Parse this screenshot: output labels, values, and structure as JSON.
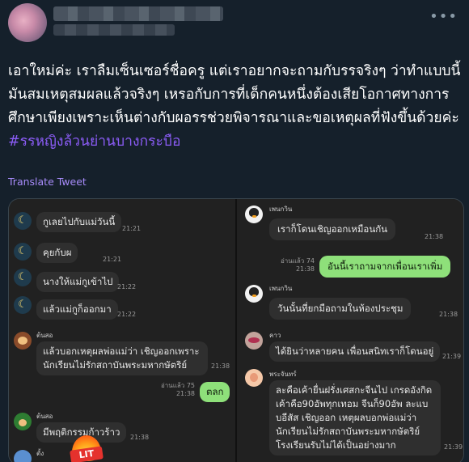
{
  "tweet": {
    "more_label": "•••",
    "text_main": "เอาใหม่ค่ะ เราลืมเซ็นเซอร์ชื่อครู แต่เราอยากจะถามกับรรจริงๆ ว่าทำแบบนี้มันสมเหตุสมผลแล้วจริงๆ เหรอกับการที่เด็กคนหนึ่งต้องเสียโอกาศทางการศึกษาเพียงเพราะเห็นต่างกับผอรรช่วยพิจารณาและขอเหตุผลที่ฟังขึ้นด้วยค่ะ ",
    "hashtag": "#รรหญิงล้วนย่านบางกระบือ",
    "translate_label": "Translate Tweet",
    "accent_color": "#8b5cf6"
  },
  "left_chat": {
    "sticker_text": "LIT",
    "messages": [
      {
        "text": "กูเลยไปกับแม่วันนี้",
        "time": "21:21"
      },
      {
        "text": "คุยกับผ",
        "time": "21:21"
      },
      {
        "text": "นางให้แม่กูเข้าไป",
        "time": "21:22"
      },
      {
        "text": "แล้วแม่กูก็ออกมา",
        "time": "21:22"
      },
      {
        "sender": "ต้นสอ",
        "text": "แล้วบอกเหตุผลพ่อแม่ว่า เชิญออกเพราะนักเรียนไม่รักสถาบันพระมหากษัตริย์",
        "time": "21:38"
      },
      {
        "text": "ตลก",
        "read": "อ่านแล้ว 75",
        "time": "21:38"
      },
      {
        "sender": "ต้นสอ",
        "text": "มีพฤติกรรมก้าวร้าว",
        "time": "21:38"
      },
      {
        "sender": "ตั้ง"
      }
    ]
  },
  "right_chat": {
    "messages": [
      {
        "sender": "เพนกวิน",
        "text": "เราก็โดนเชิญออกเหมือนกัน",
        "time": "21:38"
      },
      {
        "text": "อันนี้เราถามจากเพื่อนเราเพิ่ม",
        "read": "อ่านแล้ว 74",
        "time": "21:38"
      },
      {
        "sender": "เพนกวิน",
        "text": "วันนั้นที่ยกมือถามในห้องประชุม",
        "time": "21:38"
      },
      {
        "sender": "คาว",
        "text": "ได้ยินว่าหลายคน เพื่อนสนิทเราก็โดนอยู่",
        "time": "21:39"
      },
      {
        "sender": "พระจันทร์",
        "text": "ละคือเค้ายื่นฝรั่งเศสกะจีนไป เกรดอังกิดเค้าคือ90อัพทุกเทอม จีนก็90อัพ ละแบบอีสัส เชิญออก เหตุผลบอกพ่อแม่ว่านักเรียนไม่รักสถาบันพระมหากษัตริย์ โรงเรียนรับไม่ได้เป็นอย่างมาก",
        "time": "21:39"
      }
    ]
  }
}
